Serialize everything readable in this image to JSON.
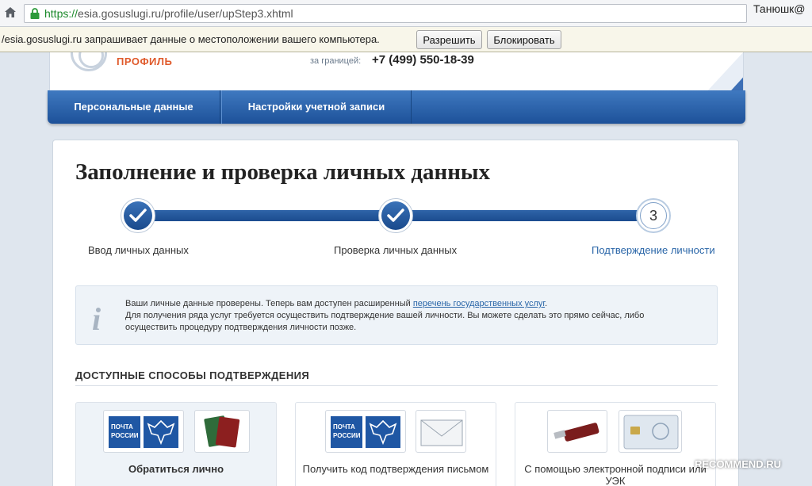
{
  "browser": {
    "url_scheme": "https://",
    "url_rest": "esia.gosuslugi.ru/profile/user/upStep3.xhtml",
    "profile_name": "Танюшк@"
  },
  "infobar": {
    "message": "/esia.gosuslugi.ru запрашивает данные о местоположении вашего компьютера.",
    "allow_label": "Разрешить",
    "block_label": "Блокировать"
  },
  "header": {
    "logo_text": "ПРОФИЛЬ",
    "abroad_label": "за границей:",
    "phone": "+7 (499) 550-18-39"
  },
  "nav": {
    "items": [
      {
        "label": "Персональные данные"
      },
      {
        "label": "Настройки учетной записи"
      }
    ]
  },
  "main": {
    "title": "Заполнение и проверка личных данных",
    "steps": [
      {
        "label": "Ввод личных данных",
        "state": "done"
      },
      {
        "label": "Проверка личных данных",
        "state": "done"
      },
      {
        "label": "Подтверждение личности",
        "state": "current",
        "number": "3"
      }
    ],
    "info": {
      "text_before_link": "Ваши личные данные проверены. Теперь вам доступен расширенный ",
      "link_text": "перечень государственных услуг",
      "text_after_link": ".",
      "text_line2": "Для получения ряда услуг требуется осуществить подтверждение вашей личности. Вы можете сделать это прямо сейчас, либо осуществить процедуру подтверждения личности позже."
    },
    "section_title": "ДОСТУПНЫЕ СПОСОБЫ ПОДТВЕРЖДЕНИЯ",
    "methods": [
      {
        "label": "Обратиться лично",
        "pochta_text": "ПОЧТА РОССИИ"
      },
      {
        "label": "Получить код подтверждения письмом",
        "pochta_text": "ПОЧТА РОССИИ"
      },
      {
        "label": "С помощью электронной подписи или УЭК"
      }
    ]
  },
  "watermark": "RECOMMEND.RU",
  "colors": {
    "nav_blue": "#1d5199",
    "link_blue": "#2a66a8",
    "logo_orange": "#e05a2b"
  }
}
